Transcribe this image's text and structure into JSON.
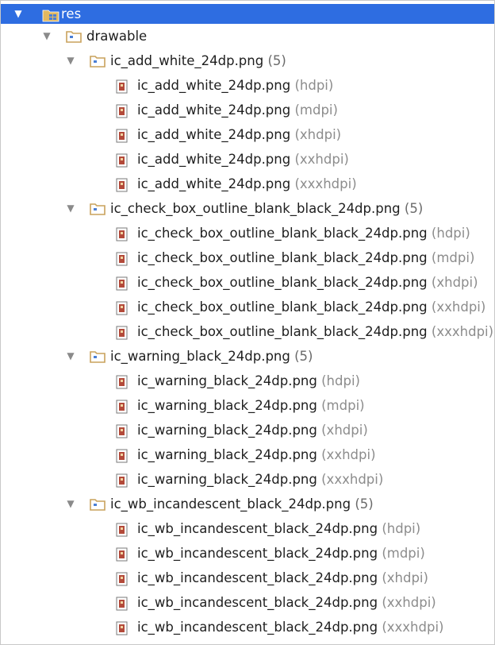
{
  "root": {
    "label": "res",
    "expanded": true,
    "selected": true,
    "icon": "resource-folder-icon"
  },
  "drawable": {
    "label": "drawable",
    "expanded": true,
    "icon": "folder-icon"
  },
  "groups": [
    {
      "name": "ic_add_white_24dp.png",
      "count": "(5)",
      "files": [
        {
          "name": "ic_add_white_24dp.png",
          "qualifier": "(hdpi)"
        },
        {
          "name": "ic_add_white_24dp.png",
          "qualifier": "(mdpi)"
        },
        {
          "name": "ic_add_white_24dp.png",
          "qualifier": "(xhdpi)"
        },
        {
          "name": "ic_add_white_24dp.png",
          "qualifier": "(xxhdpi)"
        },
        {
          "name": "ic_add_white_24dp.png",
          "qualifier": "(xxxhdpi)"
        }
      ]
    },
    {
      "name": "ic_check_box_outline_blank_black_24dp.png",
      "count": "(5)",
      "files": [
        {
          "name": "ic_check_box_outline_blank_black_24dp.png",
          "qualifier": "(hdpi)"
        },
        {
          "name": "ic_check_box_outline_blank_black_24dp.png",
          "qualifier": "(mdpi)"
        },
        {
          "name": "ic_check_box_outline_blank_black_24dp.png",
          "qualifier": "(xhdpi)"
        },
        {
          "name": "ic_check_box_outline_blank_black_24dp.png",
          "qualifier": "(xxhdpi)"
        },
        {
          "name": "ic_check_box_outline_blank_black_24dp.png",
          "qualifier": "(xxxhdpi)"
        }
      ]
    },
    {
      "name": "ic_warning_black_24dp.png",
      "count": "(5)",
      "files": [
        {
          "name": "ic_warning_black_24dp.png",
          "qualifier": "(hdpi)"
        },
        {
          "name": "ic_warning_black_24dp.png",
          "qualifier": "(mdpi)"
        },
        {
          "name": "ic_warning_black_24dp.png",
          "qualifier": "(xhdpi)"
        },
        {
          "name": "ic_warning_black_24dp.png",
          "qualifier": "(xxhdpi)"
        },
        {
          "name": "ic_warning_black_24dp.png",
          "qualifier": "(xxxhdpi)"
        }
      ]
    },
    {
      "name": "ic_wb_incandescent_black_24dp.png",
      "count": "(5)",
      "files": [
        {
          "name": "ic_wb_incandescent_black_24dp.png",
          "qualifier": "(hdpi)"
        },
        {
          "name": "ic_wb_incandescent_black_24dp.png",
          "qualifier": "(mdpi)"
        },
        {
          "name": "ic_wb_incandescent_black_24dp.png",
          "qualifier": "(xhdpi)"
        },
        {
          "name": "ic_wb_incandescent_black_24dp.png",
          "qualifier": "(xxhdpi)"
        },
        {
          "name": "ic_wb_incandescent_black_24dp.png",
          "qualifier": "(xxxhdpi)"
        }
      ]
    }
  ],
  "colors": {
    "selection": "#2e6de1",
    "folder": "#c9a25c",
    "qualifier_text": "#8c8c8c",
    "file_icon": "#b34a3a"
  }
}
